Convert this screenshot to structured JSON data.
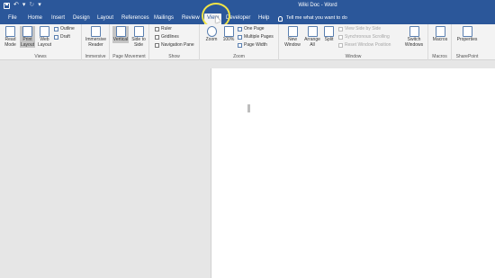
{
  "title_bar": {
    "doc_title": "Wiki Doc - Word",
    "undo_glyph": "↶",
    "redo_glyph": "↻",
    "dropdown_glyph": "▾"
  },
  "tabs": [
    {
      "label": "File"
    },
    {
      "label": "Home"
    },
    {
      "label": "Insert"
    },
    {
      "label": "Design"
    },
    {
      "label": "Layout"
    },
    {
      "label": "References"
    },
    {
      "label": "Mailings"
    },
    {
      "label": "Review"
    },
    {
      "label": "View"
    },
    {
      "label": "Developer"
    },
    {
      "label": "Help"
    }
  ],
  "tell_me": "Tell me what you want to do",
  "ribbon": {
    "views": {
      "label": "Views",
      "read_mode": "Read Mode",
      "print_layout": "Print Layout",
      "web_layout": "Web Layout",
      "outline": "Outline",
      "draft": "Draft"
    },
    "immersive": {
      "label": "Immersive",
      "immersive_reader": "Immersive Reader"
    },
    "page_movement": {
      "label": "Page Movement",
      "vertical": "Vertical",
      "side_to_side": "Side to Side"
    },
    "show": {
      "label": "Show",
      "ruler": "Ruler",
      "gridlines": "Gridlines",
      "navigation_pane": "Navigation Pane"
    },
    "zoom": {
      "label": "Zoom",
      "zoom": "Zoom",
      "percent": "100%",
      "one_page": "One Page",
      "multiple_pages": "Multiple Pages",
      "page_width": "Page Width"
    },
    "window": {
      "label": "Window",
      "new_window": "New Window",
      "arrange_all": "Arrange All",
      "split": "Split",
      "view_side_by_side": "View Side by Side",
      "synchronous_scrolling": "Synchronous Scrolling",
      "reset_window_position": "Reset Window Position",
      "switch_windows": "Switch Windows"
    },
    "macros": {
      "label": "Macros",
      "macros": "Macros"
    },
    "sharepoint": {
      "label": "SharePoint",
      "properties": "Properties"
    }
  }
}
